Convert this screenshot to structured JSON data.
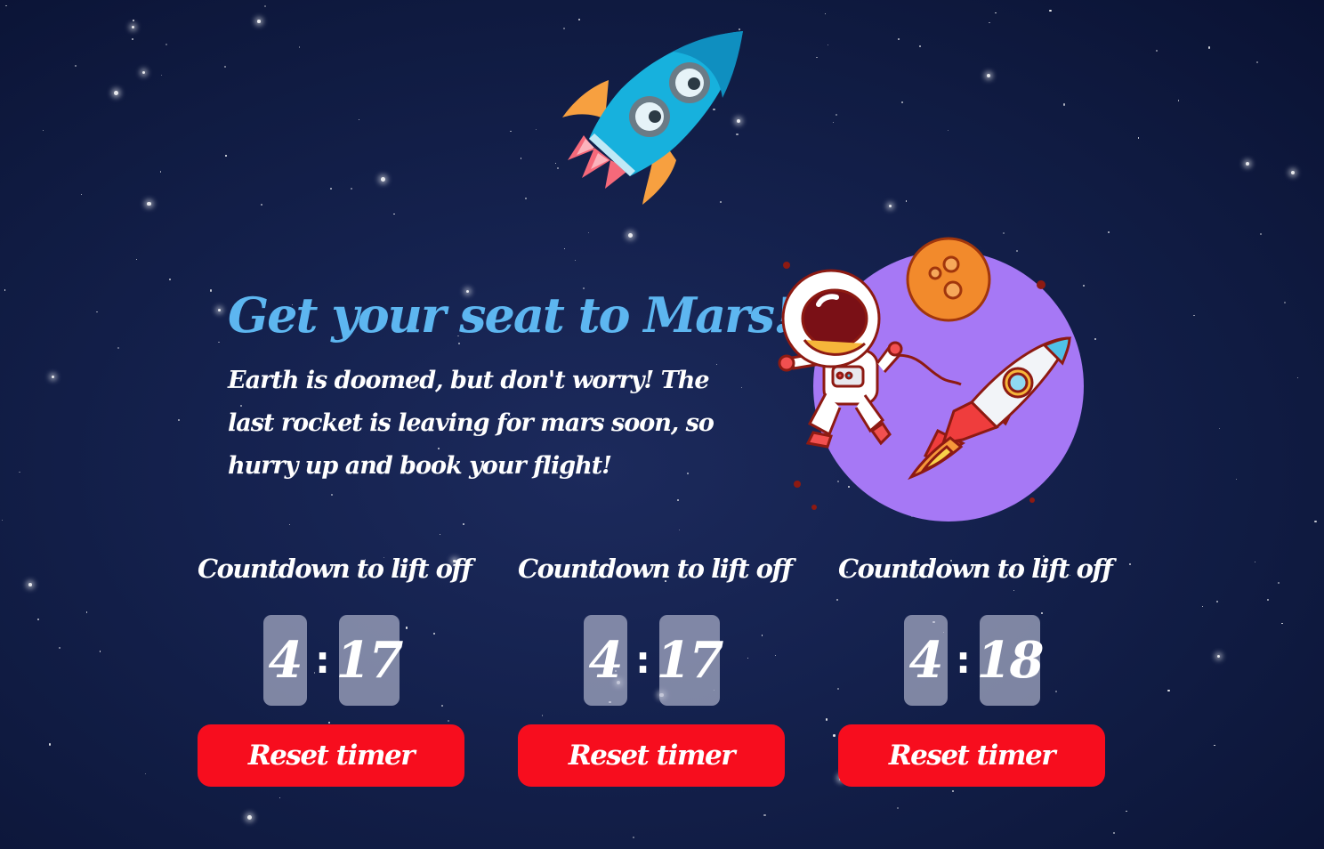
{
  "hero": {
    "title": "Get your seat to Mars!",
    "description": "Earth is doomed, but don't worry! The last rocket is leaving for mars soon, so hurry up and book your flight!"
  },
  "timers": [
    {
      "label": "Countdown to lift off",
      "minutes": "4",
      "separator": ":",
      "seconds": "17",
      "button": "Reset timer"
    },
    {
      "label": "Countdown to lift off",
      "minutes": "4",
      "separator": ":",
      "seconds": "17",
      "button": "Reset timer"
    },
    {
      "label": "Countdown to lift off",
      "minutes": "4",
      "separator": ":",
      "seconds": "18",
      "button": "Reset timer"
    }
  ],
  "colors": {
    "background": "#15224f",
    "title": "#5db6f0",
    "button": "#f70d1e",
    "digit_box": "#8f94ad",
    "planet": "#a678f5"
  }
}
